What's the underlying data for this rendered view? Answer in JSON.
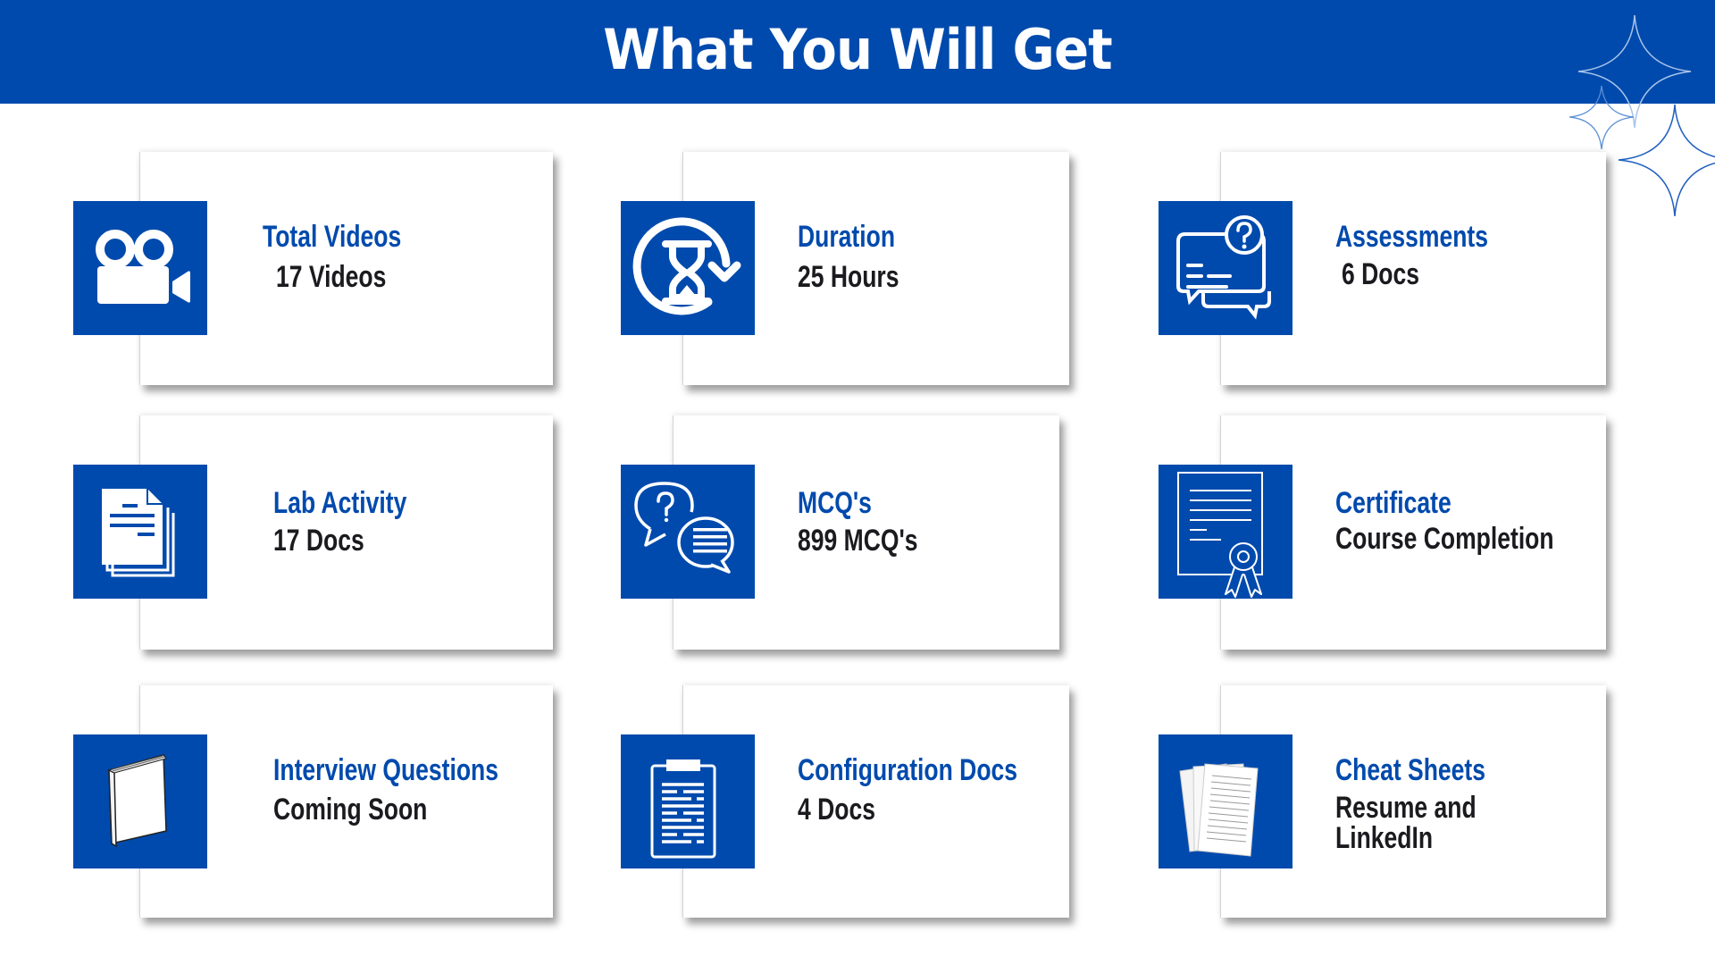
{
  "header": {
    "title": "What You Will Get"
  },
  "colors": {
    "brand_blue": "#004AAD",
    "value_text": "#1b1b1f",
    "background": "#ffffff"
  },
  "cards": [
    {
      "title": "Total Videos",
      "value": "17 Videos",
      "icon": "video-camera-icon"
    },
    {
      "title": "Duration",
      "value": "25 Hours",
      "icon": "hourglass-refresh-icon"
    },
    {
      "title": "Assessments",
      "value": "6 Docs",
      "icon": "question-chat-icon"
    },
    {
      "title": "Lab Activity",
      "value": "17 Docs",
      "icon": "documents-stack-icon"
    },
    {
      "title": "MCQ's",
      "value": "899 MCQ's",
      "icon": "speech-bubbles-question-icon"
    },
    {
      "title": "Certificate",
      "value": "Course Completion",
      "icon": "certificate-ribbon-icon"
    },
    {
      "title": "Interview Questions",
      "value": "Coming Soon",
      "icon": "book-icon"
    },
    {
      "title": "Configuration Docs",
      "value": "4 Docs",
      "icon": "clipboard-icon"
    },
    {
      "title": "Cheat Sheets",
      "value": "Resume and",
      "value_line2": "LinkedIn",
      "icon": "paper-sheets-icon"
    }
  ]
}
